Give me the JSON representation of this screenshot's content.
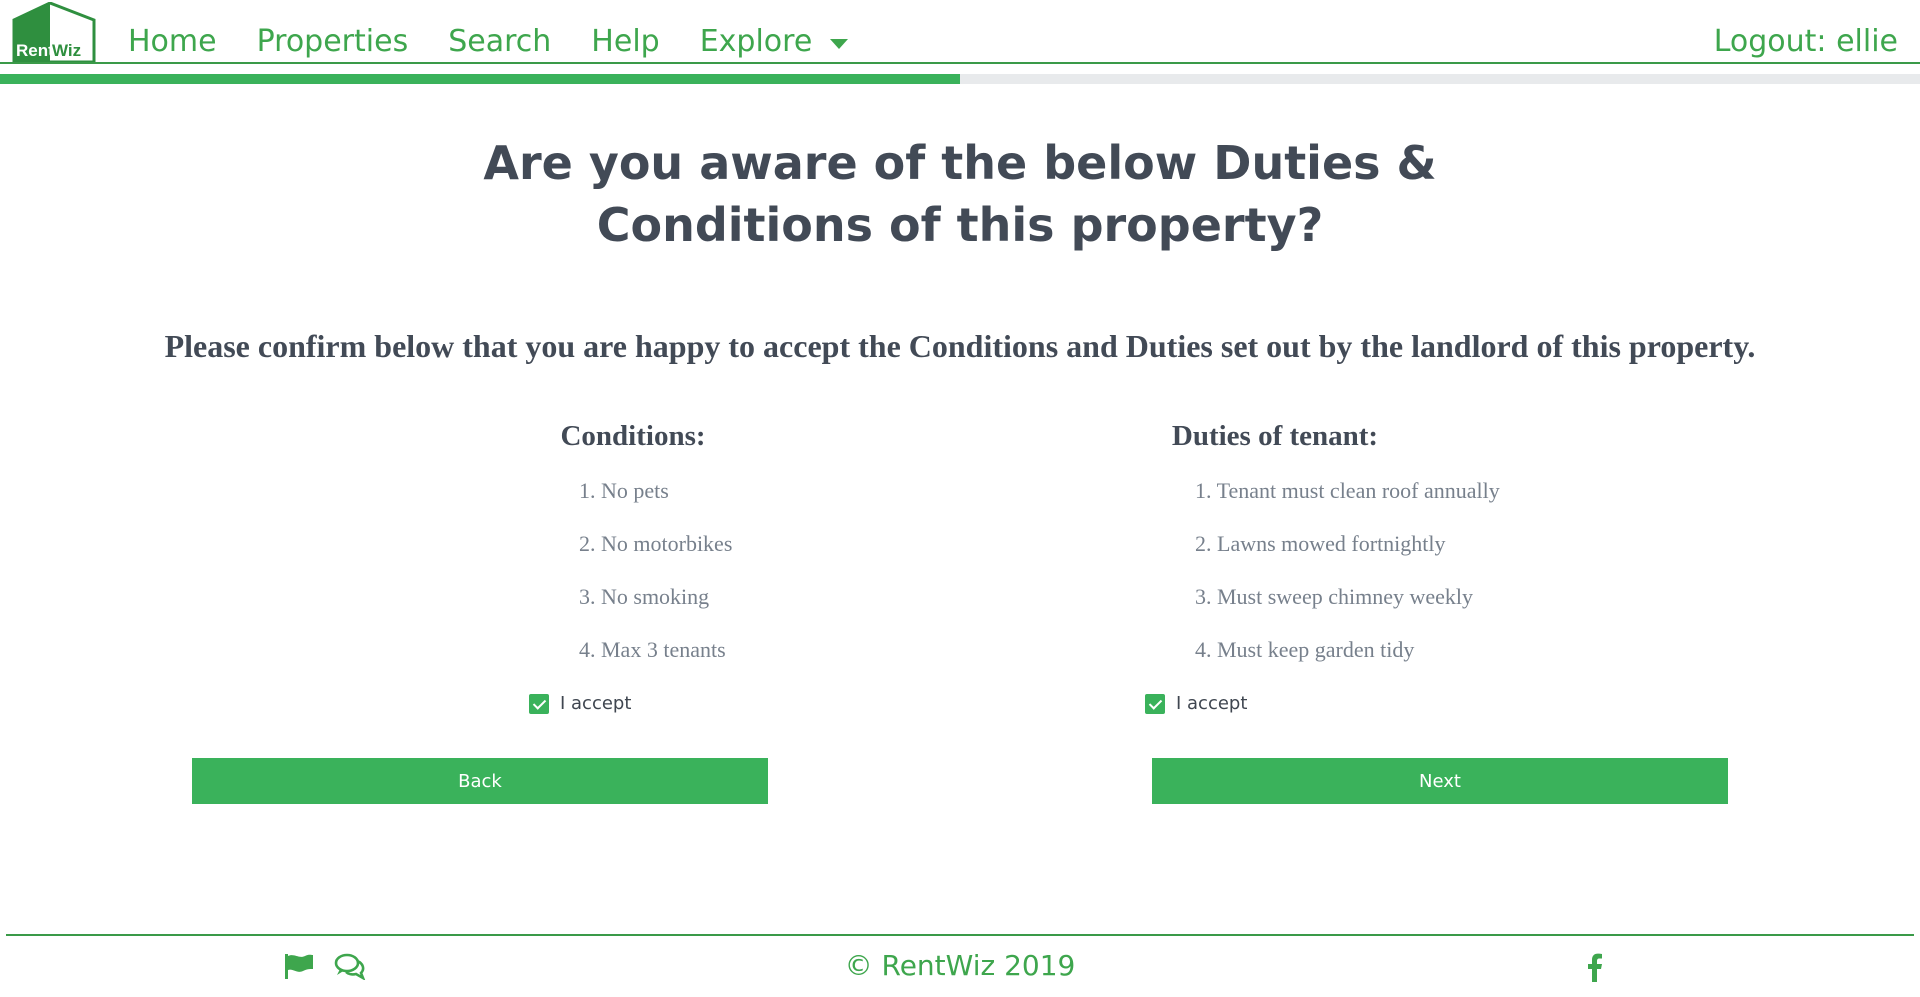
{
  "brand": {
    "logo_text_left": "Rent",
    "logo_text_right": "Wiz",
    "color_primary": "#3ab25b",
    "color_nav_text": "#3ea64d"
  },
  "nav": {
    "links": [
      {
        "label": "Home"
      },
      {
        "label": "Properties"
      },
      {
        "label": "Search"
      },
      {
        "label": "Help"
      },
      {
        "label": "Explore"
      }
    ],
    "logout_label": "Logout: ellie"
  },
  "progress": {
    "fraction": 0.5
  },
  "main": {
    "title_line1": "Are you aware of the below Duties &",
    "title_line2": "Conditions of this property?",
    "subtitle": "Please confirm below that you are happy to accept the Conditions and Duties set out by the landlord of this property.",
    "conditions": {
      "heading": "Conditions:",
      "items": [
        "1. No pets",
        "2. No motorbikes",
        "3. No smoking",
        "4. Max 3 tenants"
      ],
      "accept_label": "I accept",
      "accepted": true
    },
    "duties": {
      "heading": "Duties of tenant:",
      "items": [
        "1. Tenant must clean roof annually",
        "2. Lawns mowed fortnightly",
        "3. Must sweep chimney weekly",
        "4. Must keep garden tidy"
      ],
      "accept_label": "I accept",
      "accepted": true
    },
    "back_label": "Back",
    "next_label": "Next"
  },
  "footer": {
    "copyright": "© RentWiz 2019",
    "icons": [
      "flag-icon",
      "chat-icon",
      "facebook-icon"
    ]
  }
}
